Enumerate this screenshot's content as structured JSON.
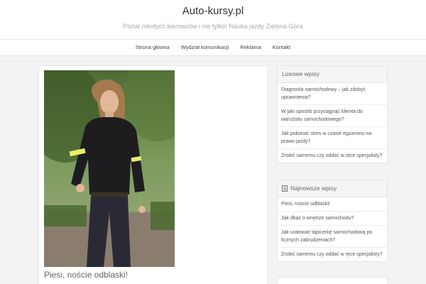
{
  "header": {
    "site_title": "Auto-kursy.pl",
    "tagline": "Portal młodych kierowców i nie tylko! Nauka jazdy Zielona Góra"
  },
  "nav": {
    "items": [
      "Strona główna",
      "Wydział komunikacji",
      "Reklama",
      "Kontakt"
    ]
  },
  "post": {
    "title": "Piesi, noście odblaski!"
  },
  "random_widget": {
    "title": "Losowe wpisy",
    "items": [
      "Diagnosta samochodowy – jak zdobyć uprawnienia?",
      "W jaki sposób przyciągnąć klienta do warsztatu samochodowego?",
      "Jak pokonać stres w czasie egzaminu na prawo jazdy?",
      "Zrobić samemu czy oddać w ręce specjalisty?"
    ]
  },
  "recent_widget": {
    "title": "Najnowsze wpisy",
    "icon": "document-icon",
    "items": [
      "Piesi, noście odblaski!",
      "Jak dbać o wnętrze samochodu?",
      "Jak uratować tapicerkę samochodową po licznych zabrudzeniach?",
      "Zrobić samemu czy oddać w ręce specjalisty?"
    ]
  }
}
